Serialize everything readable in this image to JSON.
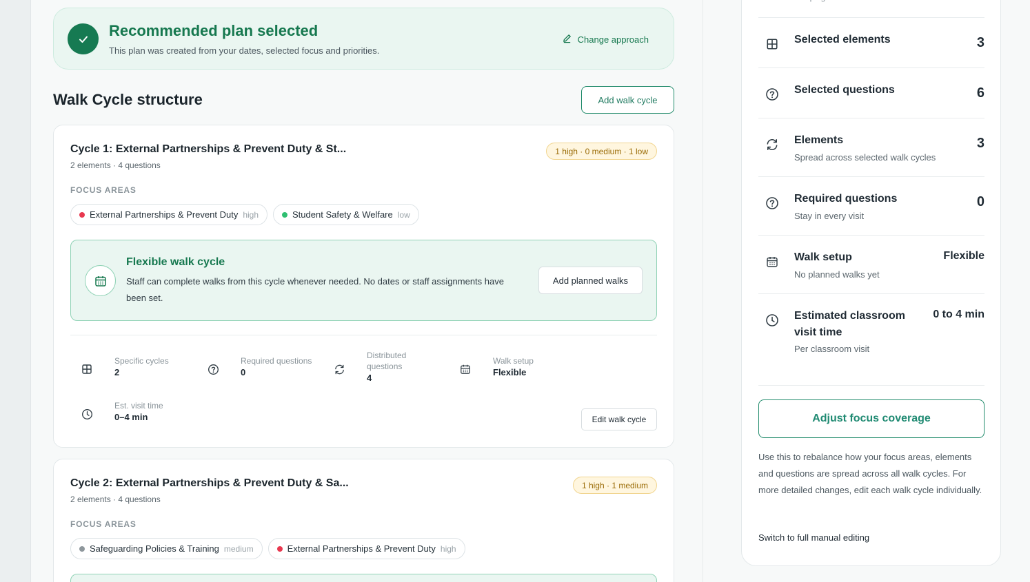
{
  "banner": {
    "title": "Recommended plan selected",
    "subtitle": "This plan was created from your dates, selected focus and priorities.",
    "change_label": "Change approach"
  },
  "section": {
    "title": "Walk Cycle structure",
    "add_label": "Add walk cycle"
  },
  "cycles": [
    {
      "title": "Cycle 1: External Partnerships & Prevent Duty & St...",
      "meta": "2 elements · 4 questions",
      "badge": "1 high · 0 medium · 1 low",
      "focus_label": "FOCUS AREAS",
      "chips": [
        {
          "name": "External Partnerships & Prevent Duty",
          "level": "high",
          "color": "#e8384f"
        },
        {
          "name": "Student Safety & Welfare",
          "level": "low",
          "color": "#2fbf71"
        }
      ],
      "flex": {
        "title": "Flexible walk cycle",
        "desc": "Staff can complete walks from this cycle whenever needed. No dates or staff assignments have been set.",
        "button": "Add planned walks"
      },
      "stats": [
        {
          "label": "Specific cycles",
          "value": "2",
          "icon": "grid-icon"
        },
        {
          "label": "Required questions",
          "value": "0",
          "icon": "question-icon"
        },
        {
          "label": "Distributed questions",
          "value": "4",
          "icon": "refresh-icon"
        },
        {
          "label": "Walk setup",
          "value": "Flexible",
          "icon": "calendar-icon"
        },
        {
          "label": "Est. visit time",
          "value": "0–4 min",
          "icon": "clock-icon"
        }
      ],
      "edit_label": "Edit walk cycle"
    },
    {
      "title": "Cycle 2: External Partnerships & Prevent Duty & Sa...",
      "meta": "2 elements · 4 questions",
      "badge": "1 high · 1 medium",
      "focus_label": "FOCUS AREAS",
      "chips": [
        {
          "name": "Safeguarding Policies & Training",
          "level": "medium",
          "color": "#8e979c"
        },
        {
          "name": "External Partnerships & Prevent Duty",
          "level": "high",
          "color": "#e8384f"
        }
      ]
    }
  ],
  "summary": {
    "partial": "campaign",
    "rows": [
      {
        "title": "Selected elements",
        "value": "3",
        "icon": "grid-icon"
      },
      {
        "title": "Selected questions",
        "value": "6",
        "icon": "question-icon"
      },
      {
        "title": "Elements",
        "sub": "Spread across selected walk cycles",
        "value": "3",
        "icon": "refresh-icon"
      },
      {
        "title": "Required questions",
        "sub": "Stay in every visit",
        "value": "0",
        "icon": "question-icon"
      },
      {
        "title": "Walk setup",
        "sub": "No planned walks yet",
        "value": "Flexible",
        "icon": "calendar-icon"
      },
      {
        "title": "Estimated classroom visit time",
        "sub": "Per classroom visit",
        "value": "0 to 4 min",
        "icon": "clock-icon"
      }
    ],
    "adjust_label": "Adjust focus coverage",
    "adjust_desc": "Use this to rebalance how your focus areas, elements and questions are spread across all walk cycles. For more detailed changes, edit each walk cycle individually.",
    "manual_label": "Switch to full manual editing"
  },
  "colors": {
    "brand_green": "#16784f",
    "accent_teal": "#1f8a6a",
    "high": "#e8384f",
    "low": "#2fbf71",
    "medium": "#8e979c"
  }
}
